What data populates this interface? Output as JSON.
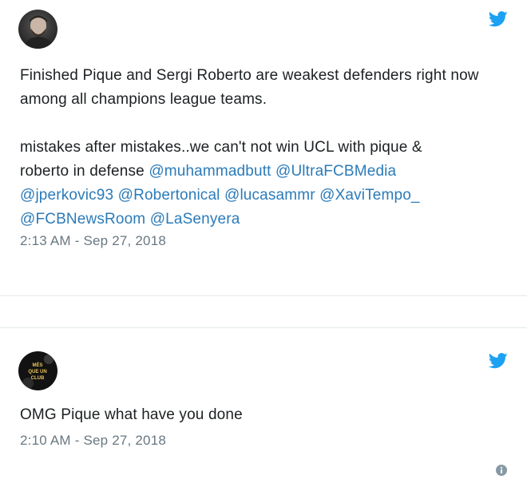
{
  "tweets": [
    {
      "paragraph1": "Finished Pique and Sergi Roberto are weakest defenders right now among all champions league teams.",
      "paragraph2_lines": [
        "mistakes after mistakes..we can't not win UCL with pique &",
        "roberto in defense"
      ],
      "mentions": [
        "@muhammadbutt",
        "@UltraFCBMedia",
        "@jperkovic93",
        "@Robertonical",
        "@lucasammr",
        "@XaviTempo_",
        "@FCBNewsRoom",
        "@LaSenyera"
      ],
      "timestamp": "2:13 AM - Sep 27, 2018",
      "avatar_icon": "user-avatar-portrait",
      "logo_icon": "twitter-bird-icon"
    },
    {
      "text": "OMG Pique what have you done",
      "timestamp": "2:10 AM - Sep 27, 2018",
      "avatar_text": "MÉS QUE UN CLUB",
      "avatar_icon": "club-avatar",
      "logo_icon": "twitter-bird-icon",
      "info_icon": "info-icon"
    }
  ],
  "colors": {
    "text": "#1c2022",
    "link": "#2b7bb9",
    "meta": "#697882",
    "twitter_blue": "#1da1f2",
    "divider": "#e1e8ed"
  }
}
